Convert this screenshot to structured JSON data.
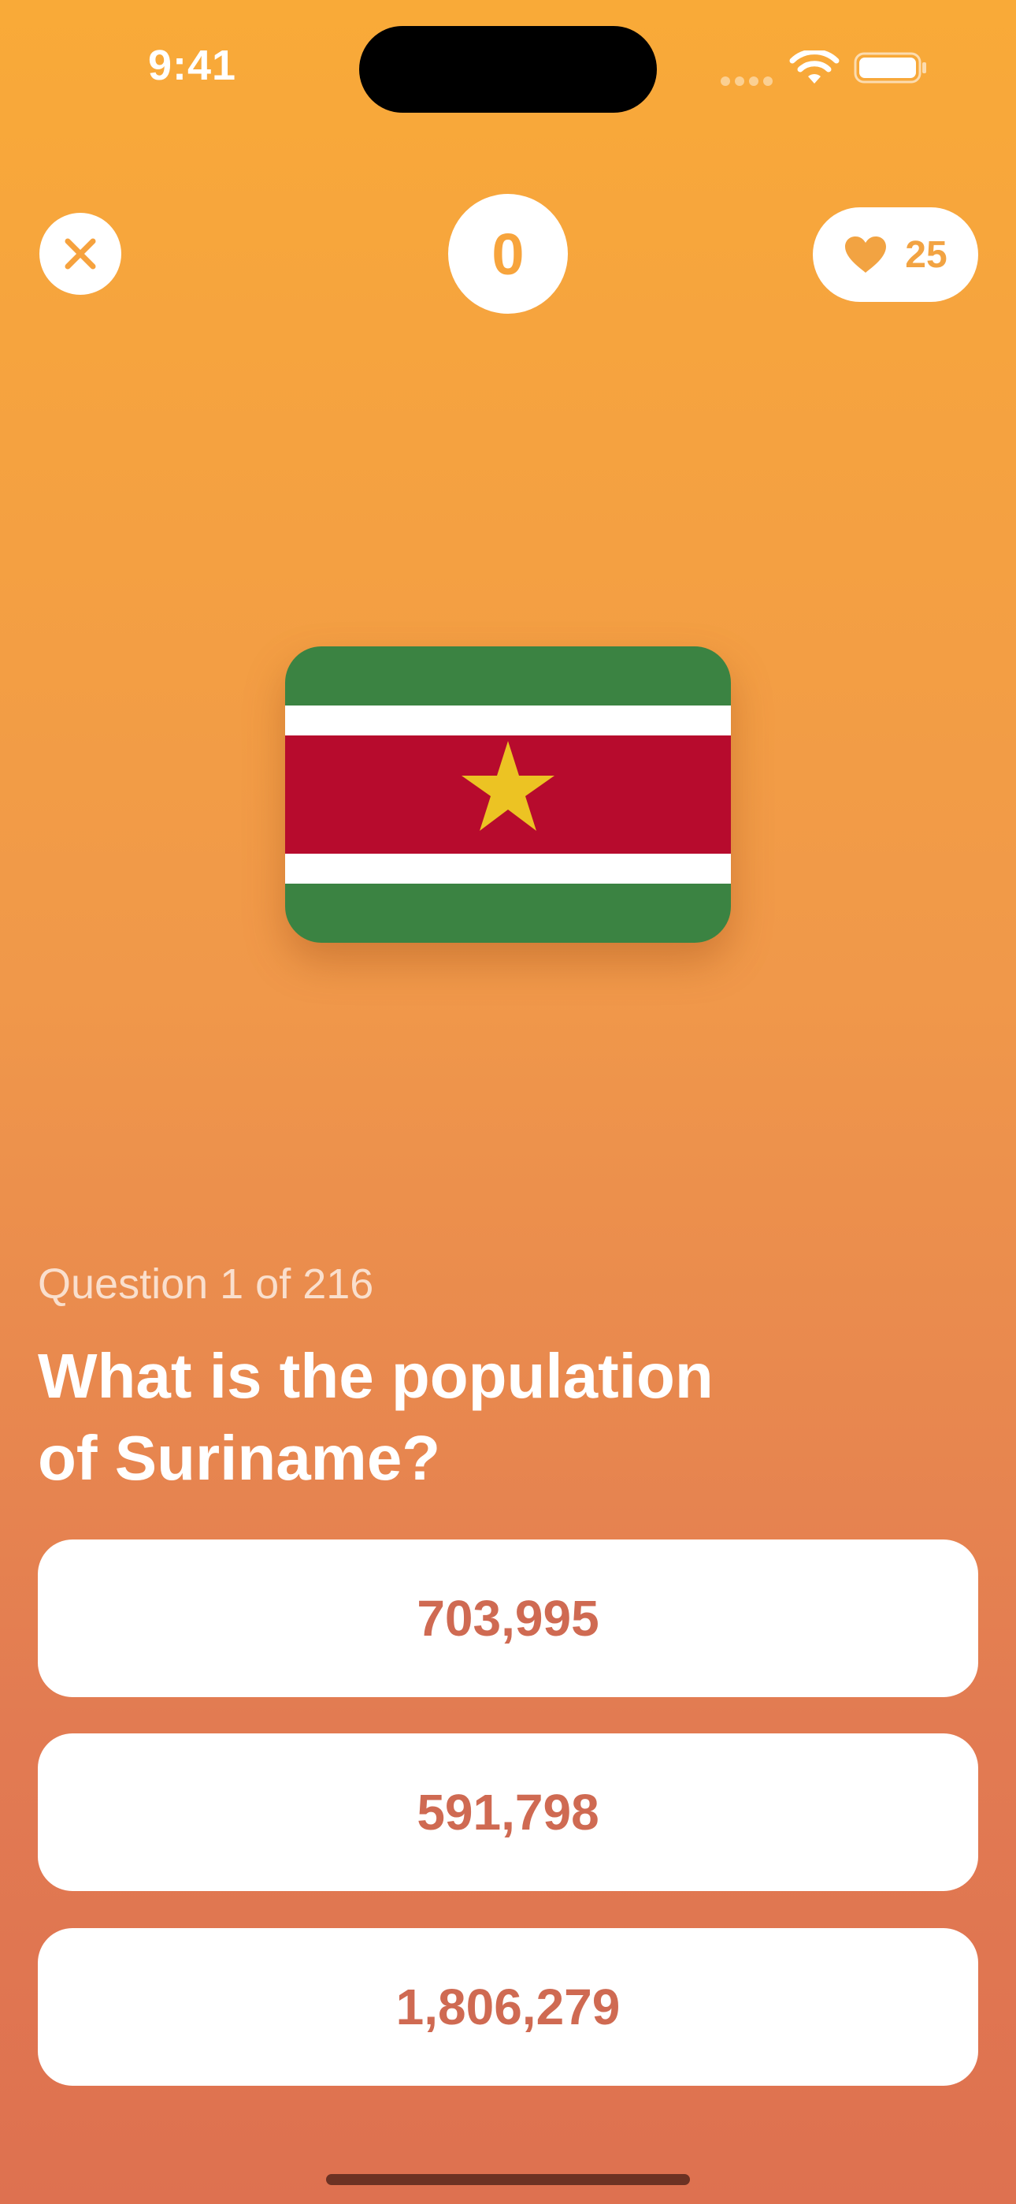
{
  "status_bar": {
    "time": "9:41"
  },
  "header": {
    "close_icon": "close-icon",
    "score": "0",
    "lives": {
      "icon": "heart-icon",
      "count": "25"
    }
  },
  "flag": {
    "country": "Suriname",
    "colors": {
      "green": "#3B8342",
      "white": "#FFFFFF",
      "red": "#B70B2D",
      "star": "#ECC323"
    }
  },
  "question": {
    "counter": "Question 1 of 216",
    "line1": "What is the population",
    "line2": "of Suriname?"
  },
  "answers": [
    {
      "label": "703,995"
    },
    {
      "label": "591,798"
    },
    {
      "label": "1,806,279"
    }
  ],
  "theme": {
    "gradient_top": "#F9AA38",
    "gradient_bottom": "#DE7150",
    "answer_text": "#CF6A52",
    "accent": "#F7A43C"
  }
}
